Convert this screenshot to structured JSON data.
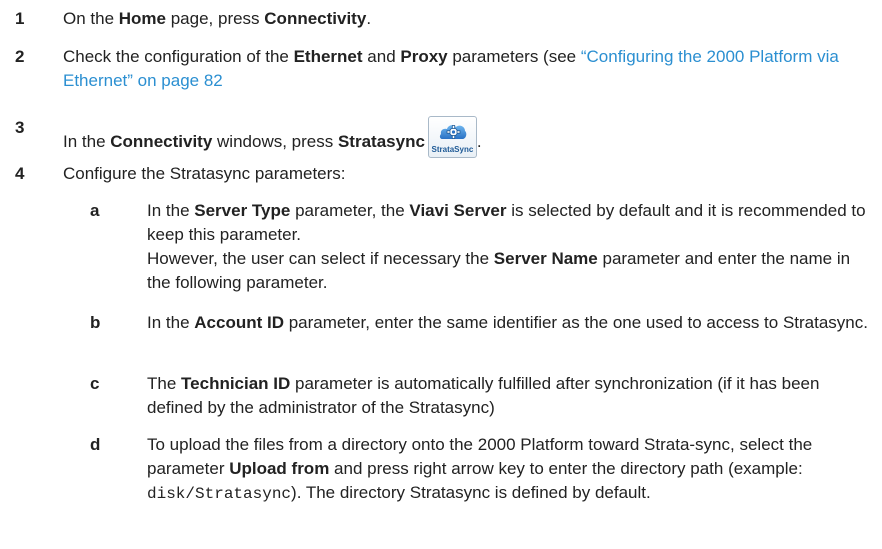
{
  "steps": [
    {
      "num": "1",
      "t1": "On the ",
      "b1": "Home",
      "t2": " page, press ",
      "b2": "Connectivity",
      "t3": "."
    },
    {
      "num": "2",
      "t1": "Check the configuration of the ",
      "b1": "Ethernet",
      "t2": " and ",
      "b2": "Proxy",
      "t3": " parameters (see ",
      "link": "“Configuring the 2000 Platform via Ethernet” on page 82"
    },
    {
      "num": "3",
      "t1": "In the ",
      "b1": "Connectivity",
      "t2": " windows, press ",
      "b2": "Stratasync",
      "t3": ".",
      "icon_label": "StrataSync",
      "icon": "stratasync-gear-icon"
    },
    {
      "num": "4",
      "t1": "Configure the Stratasync parameters:"
    }
  ],
  "substeps": [
    {
      "letter": "a",
      "t1": "In the ",
      "b1": "Server Type",
      "t2": " parameter, the ",
      "b2": "Viavi Server",
      "t3": " is selected by default and it is recommended to keep this parameter.",
      "t4": "However, the user can select if necessary the ",
      "b3": "Server Name",
      "t5": " parameter and enter the name in the following parameter."
    },
    {
      "letter": "b",
      "t1": "In the ",
      "b1": "Account ID",
      "t2": " parameter, enter the same identifier as the one used to access to Stratasync."
    },
    {
      "letter": "c",
      "t1": "The ",
      "b1": "Technician ID",
      "t2": " parameter is automatically fulfilled after synchronization (if it has been defined by the administrator of the Stratasync)"
    },
    {
      "letter": "d",
      "t1": "To upload the files from a directory onto the 2000 Platform toward Strata-sync, select the parameter ",
      "b1": "Upload from",
      "t2": " and press right arrow key to enter the directory path (example: ",
      "code": "disk/Stratasync",
      "t3": "). The directory Stratasync is defined by default."
    }
  ]
}
